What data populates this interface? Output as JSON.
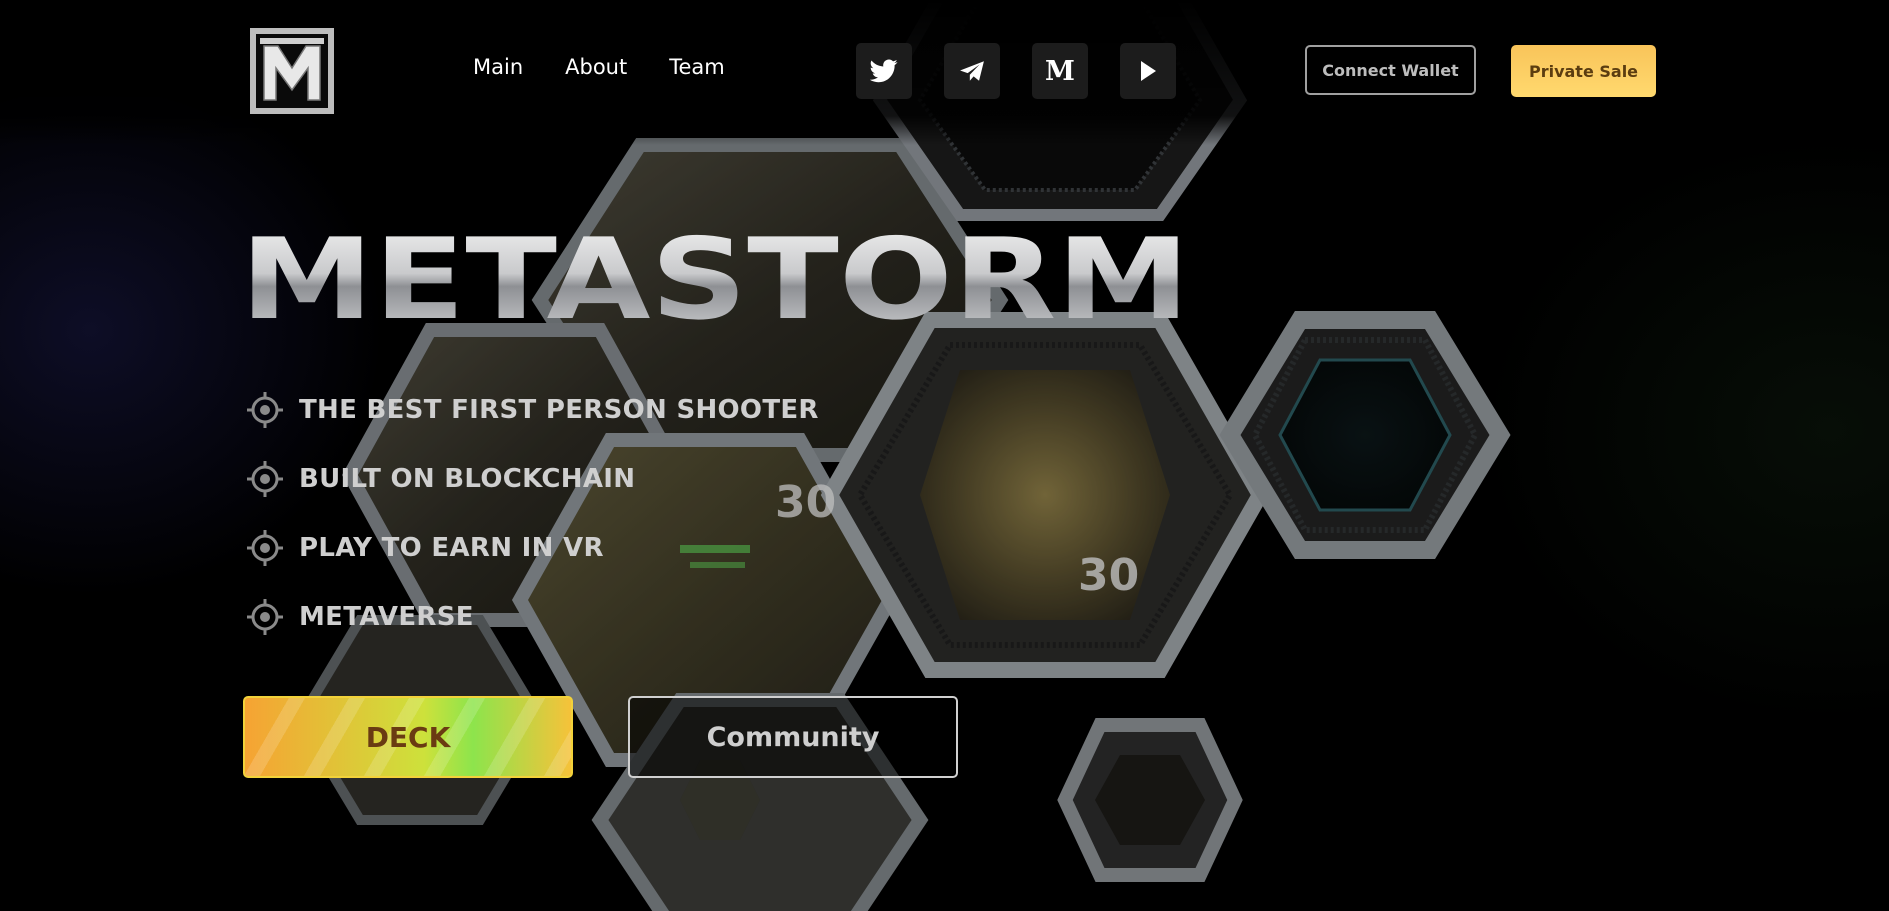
{
  "brand": {
    "logo_letter": "M",
    "name": "METASTORM"
  },
  "nav": {
    "items": [
      {
        "label": "Main"
      },
      {
        "label": "About"
      },
      {
        "label": "Team"
      }
    ]
  },
  "socials": [
    {
      "icon": "twitter-icon"
    },
    {
      "icon": "telegram-icon"
    },
    {
      "icon": "medium-icon",
      "glyph": "M"
    },
    {
      "icon": "youtube-play-icon"
    }
  ],
  "header_buttons": {
    "connect_wallet": "Connect Wallet",
    "private_sale": "Private Sale"
  },
  "hero": {
    "title": "METASTORM",
    "features": [
      "THE BEST FIRST PERSON SHOOTER",
      "BUILT ON BLOCKCHAIN",
      "PLAY TO EARN IN VR",
      "METAVERSE"
    ],
    "deck_label": "DECK",
    "community_label": "Community",
    "hud_numbers": [
      "30",
      "30"
    ]
  },
  "colors": {
    "background": "#000000",
    "accent_yellow": "#ffd96e",
    "deck_green": "#8de44c",
    "deck_orange": "#f6a333",
    "hex_frame": "#9aa0a4"
  }
}
